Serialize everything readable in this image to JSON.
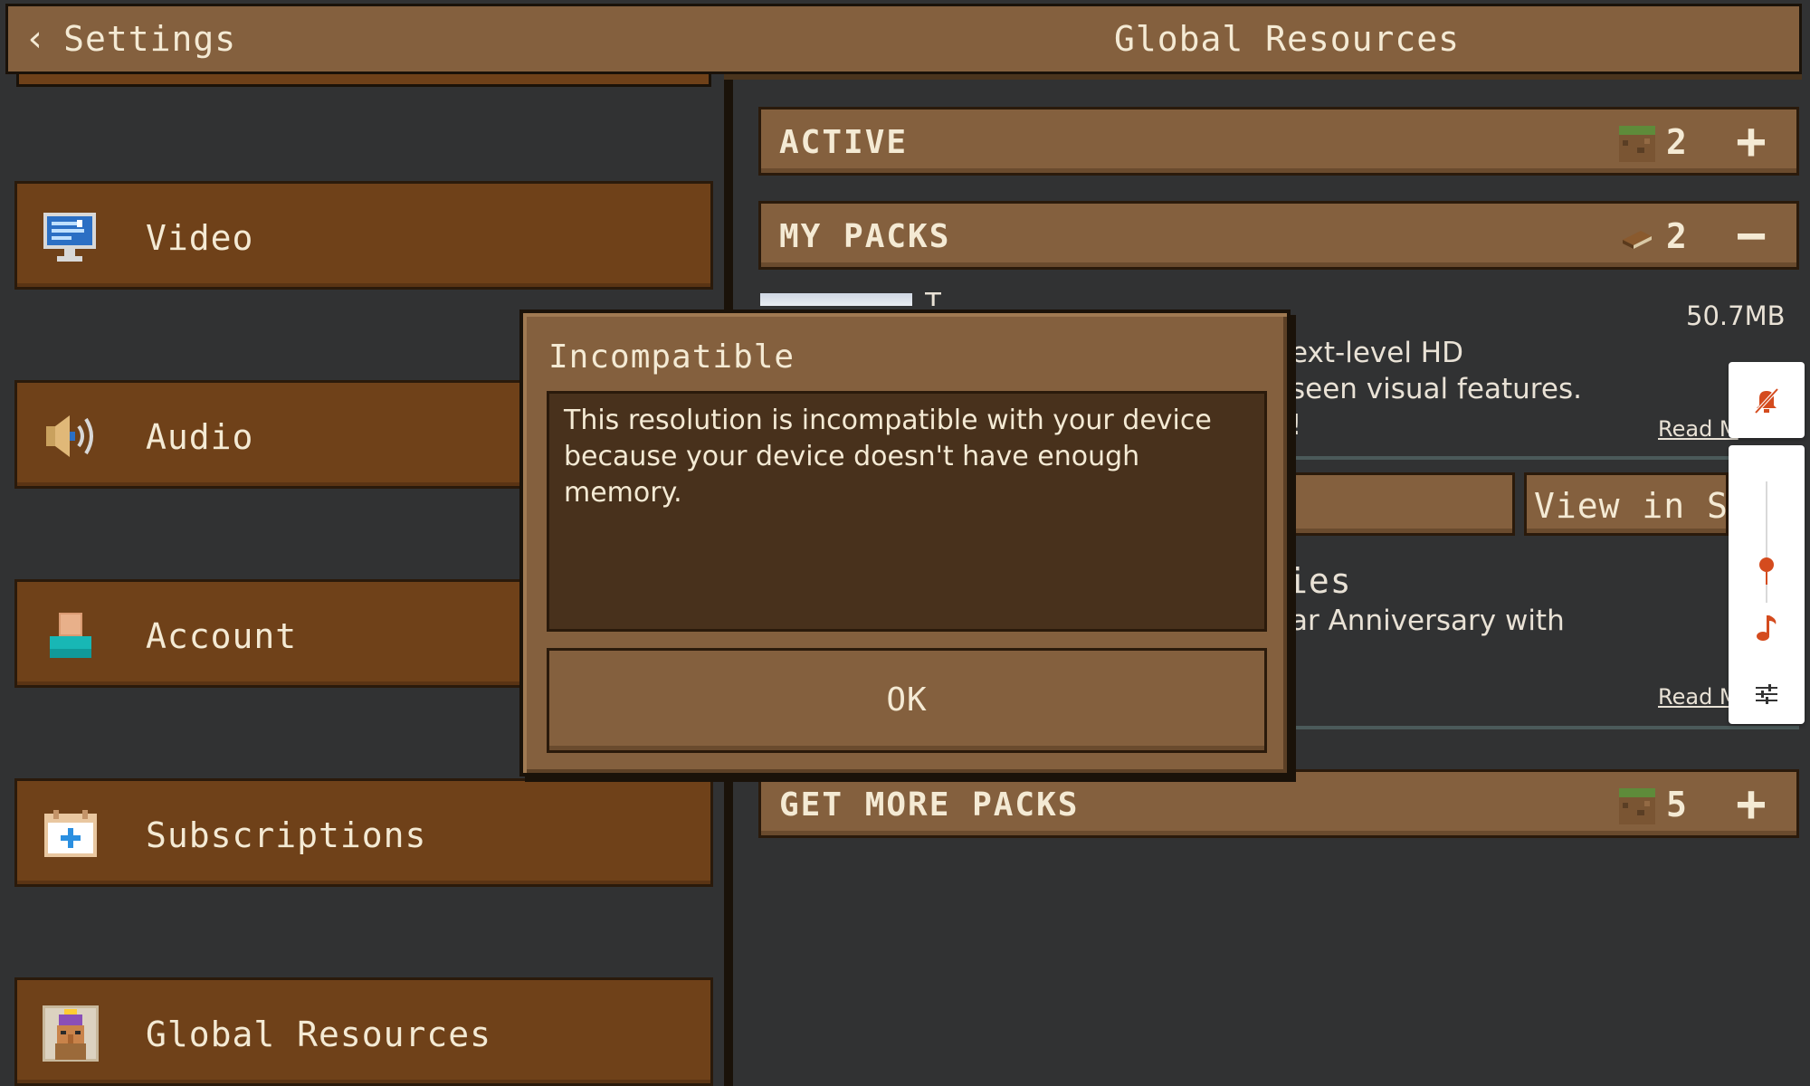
{
  "header": {
    "back_label": "Settings",
    "title": "Global Resources"
  },
  "sidebar": {
    "items": [
      {
        "label": "Video",
        "icon": "monitor-icon"
      },
      {
        "label": "Audio",
        "icon": "speaker-icon"
      },
      {
        "label": "Account",
        "icon": "user-icon"
      },
      {
        "label": "Subscriptions",
        "icon": "calendar-plus-icon"
      },
      {
        "label": "Global Resources",
        "icon": "villager-icon"
      }
    ]
  },
  "sections": {
    "active": {
      "title": "ACTIVE",
      "count": "2",
      "action": "+"
    },
    "my_packs": {
      "title": "MY PACKS",
      "count": "2",
      "action": "−"
    },
    "get_more": {
      "title": "GET MORE PACKS",
      "count": "5",
      "action": "+"
    }
  },
  "pack1": {
    "size": "50.7MB",
    "desc_line1": "ext-level HD",
    "desc_line2": "seen visual features.",
    "desc_line3": "!",
    "read_more": "Read M",
    "view_store": "View in Stor"
  },
  "pack2": {
    "title_fragment": "ies",
    "desc_line1": "ar Anniversary with",
    "read_more": "Read M"
  },
  "modal": {
    "title": "Incompatible",
    "message": "This resolution is incompatible with your device because your device doesn't have enough memory.",
    "ok_label": "OK"
  },
  "colors": {
    "accent": "#d44b1e",
    "panel_brown": "#84603e",
    "sidebar_brown": "#6f4119",
    "background": "#313233"
  }
}
